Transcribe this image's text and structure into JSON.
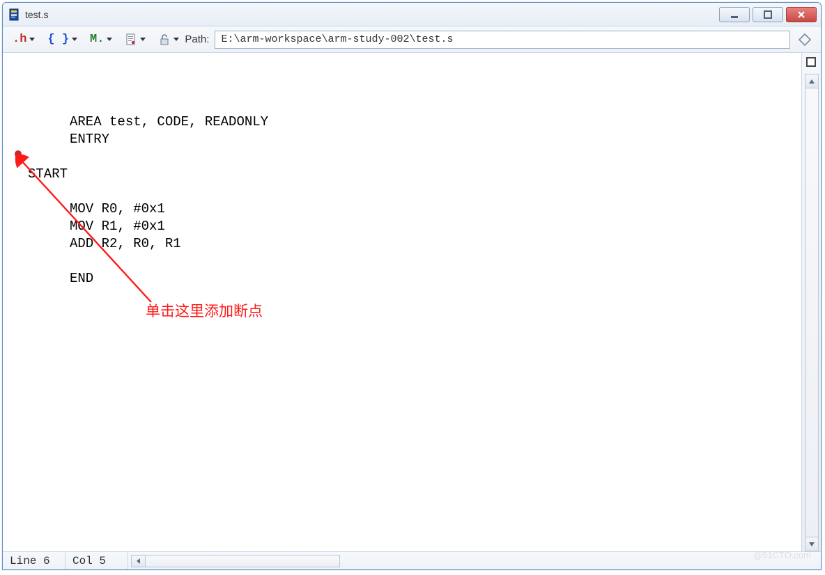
{
  "window": {
    "title": "test.s"
  },
  "toolbar": {
    "path_label": "Path:",
    "path_value": "E:\\arm-workspace\\arm-study-002\\test.s",
    "items": [
      {
        "name": "h-menu",
        "glyph": ".h",
        "color": "#c0302c"
      },
      {
        "name": "braces-menu",
        "glyph": "{ }",
        "color": "#2050d0"
      },
      {
        "name": "m-menu",
        "glyph": "M.",
        "color": "#2a7a2a"
      }
    ]
  },
  "code": {
    "lines": [
      {
        "text": "AREA test, CODE, READONLY",
        "indent": "indent1"
      },
      {
        "text": "ENTRY",
        "indent": "indent1"
      },
      {
        "text": "",
        "indent": "noindent"
      },
      {
        "text": "START",
        "indent": "noindent"
      },
      {
        "text": "",
        "indent": "noindent"
      },
      {
        "text": "MOV R0, #0x1",
        "indent": "indent1"
      },
      {
        "text": "MOV R1, #0x1",
        "indent": "indent1"
      },
      {
        "text": "ADD R2, R0, R1",
        "indent": "indent1"
      },
      {
        "text": "",
        "indent": "noindent"
      },
      {
        "text": "END",
        "indent": "indent1"
      }
    ],
    "breakpoint_line": 6
  },
  "annotation": {
    "text": "单击这里添加断点"
  },
  "status": {
    "line_label": "Line 6",
    "col_label": "Col 5"
  },
  "watermark": "@51CTO.com"
}
